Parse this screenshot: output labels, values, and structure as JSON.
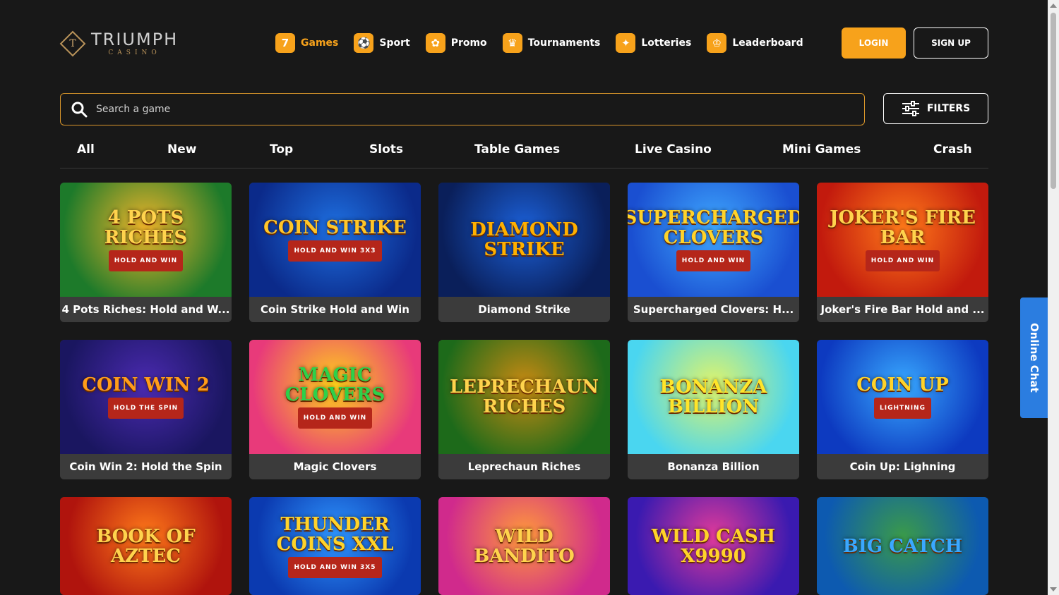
{
  "header": {
    "logo_title": "TRIUMPH",
    "logo_sub": "CASINO",
    "logo_mark": "T",
    "nav": [
      {
        "label": "Games",
        "icon": "seven-icon",
        "glyph": "7",
        "active": true
      },
      {
        "label": "Sport",
        "icon": "soccer-ball-icon",
        "glyph": "⚽",
        "active": false
      },
      {
        "label": "Promo",
        "icon": "gift-icon",
        "glyph": "✿",
        "active": false
      },
      {
        "label": "Tournaments",
        "icon": "trophy-icon",
        "glyph": "♛",
        "active": false
      },
      {
        "label": "Lotteries",
        "icon": "lottery-ticket-icon",
        "glyph": "✦",
        "active": false
      },
      {
        "label": "Leaderboard",
        "icon": "crown-icon",
        "glyph": "♔",
        "active": false
      }
    ],
    "login_label": "LOGIN",
    "signup_label": "SIGN UP"
  },
  "search": {
    "placeholder": "Search a game",
    "filters_label": "FILTERS"
  },
  "categories": [
    "All",
    "New",
    "Top",
    "Slots",
    "Table Games",
    "Live Casino",
    "Mini Games",
    "Crash"
  ],
  "games": [
    {
      "caption": "4 Pots Riches: Hold and W...",
      "art_title": "4 POTS RICHES",
      "art_sub": "HOLD AND WIN",
      "colors": [
        "#1d7a2a",
        "#f2b52a"
      ],
      "title_color": "#ffd34d"
    },
    {
      "caption": "Coin Strike Hold and Win",
      "art_title": "COIN STRIKE",
      "art_sub": "HOLD AND WIN 3X3",
      "colors": [
        "#0b2a8a",
        "#1e6fe0"
      ],
      "title_color": "#ffc629"
    },
    {
      "caption": "Diamond Strike",
      "art_title": "DIAMOND STRIKE",
      "art_sub": "",
      "colors": [
        "#0a1f5a",
        "#1b5fd6"
      ],
      "title_color": "#ffb000"
    },
    {
      "caption": "Supercharged Clovers: H...",
      "art_title": "SUPERCHARGED CLOVERS",
      "art_sub": "HOLD AND WIN",
      "colors": [
        "#1a4fd1",
        "#3fa8ff"
      ],
      "title_color": "#ffd32a"
    },
    {
      "caption": "Joker's Fire Bar Hold and ...",
      "art_title": "JOKER'S FIRE BAR",
      "art_sub": "HOLD AND WIN",
      "colors": [
        "#c21a0d",
        "#ff7a1a"
      ],
      "title_color": "#ffd34d"
    },
    {
      "caption": "Coin Win 2: Hold the Spin",
      "art_title": "COIN WIN 2",
      "art_sub": "HOLD THE SPIN",
      "colors": [
        "#1a1660",
        "#4a2ab0"
      ],
      "title_color": "#ff9d1a"
    },
    {
      "caption": "Magic Clovers",
      "art_title": "MAGIC CLOVERS",
      "art_sub": "HOLD AND WIN",
      "colors": [
        "#e83a7a",
        "#ffd21a"
      ],
      "title_color": "#2dd14a"
    },
    {
      "caption": "Leprechaun Riches",
      "art_title": "LEPRECHAUN RICHES",
      "art_sub": "",
      "colors": [
        "#1d6a1a",
        "#c98a12"
      ],
      "title_color": "#ffd34d"
    },
    {
      "caption": "Bonanza Billion",
      "art_title": "BONANZA BILLION",
      "art_sub": "",
      "colors": [
        "#4ad6f0",
        "#e0f46a"
      ],
      "title_color": "#ffe52a"
    },
    {
      "caption": "Coin Up: Lighning",
      "art_title": "COIN UP",
      "art_sub": "LIGHTNING",
      "colors": [
        "#0d3ac0",
        "#38a8ff"
      ],
      "title_color": "#ffd32a"
    },
    {
      "caption": "",
      "art_title": "BOOK OF AZTEC",
      "art_sub": "",
      "colors": [
        "#b0140d",
        "#ff7a1a"
      ],
      "title_color": "#ffd34d"
    },
    {
      "caption": "",
      "art_title": "THUNDER COINS XXL",
      "art_sub": "HOLD AND WIN 3X5",
      "colors": [
        "#0b3ab0",
        "#2f96ff"
      ],
      "title_color": "#ffd32a"
    },
    {
      "caption": "",
      "art_title": "WILD BANDITO",
      "art_sub": "",
      "colors": [
        "#d02a8c",
        "#ff9a3a"
      ],
      "title_color": "#ffd34d"
    },
    {
      "caption": "",
      "art_title": "WILD CASH X9990",
      "art_sub": "",
      "colors": [
        "#3a1ab0",
        "#e03a9a"
      ],
      "title_color": "#ffd32a"
    },
    {
      "caption": "",
      "art_title": "BIG CATCH",
      "art_sub": "",
      "colors": [
        "#0d5ab0",
        "#3a9a4a"
      ],
      "title_color": "#3aa8ff"
    }
  ],
  "chat": {
    "label": "Online Chat"
  },
  "colors": {
    "accent": "#f7a21b",
    "background": "#181818",
    "card_caption": "#3b3b3b",
    "chat": "#2b7de0"
  }
}
